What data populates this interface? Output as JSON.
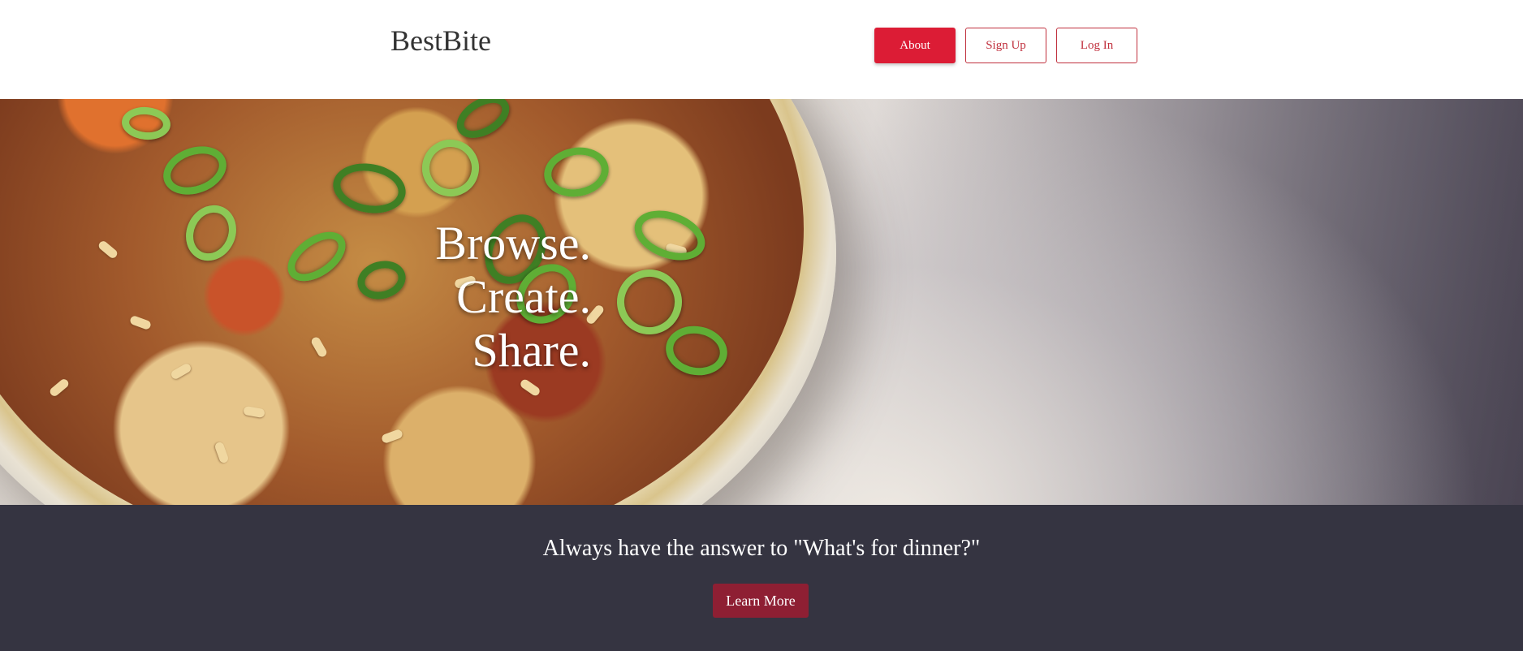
{
  "header": {
    "brand": "BestBite",
    "nav": {
      "about": "About",
      "signup": "Sign Up",
      "login": "Log In"
    }
  },
  "hero": {
    "lines": [
      "Browse.",
      "Create.",
      "Share."
    ]
  },
  "band": {
    "tagline": "Always have the answer to \"What's for dinner?\"",
    "cta": "Learn More"
  },
  "colors": {
    "primary": "#dc1c35",
    "outline": "#c0303d",
    "band_bg": "#353441",
    "cta_bg": "#8e1f33"
  }
}
